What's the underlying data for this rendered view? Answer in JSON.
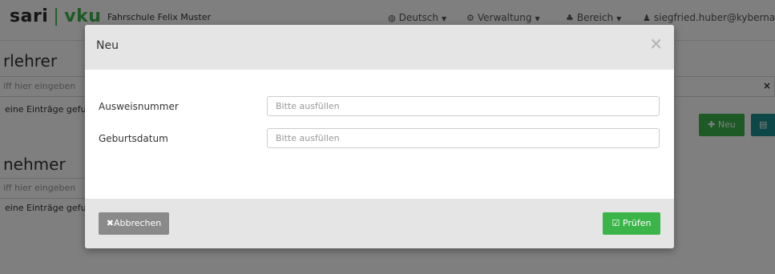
{
  "navbar": {
    "logo_sari": "sari",
    "logo_sep": "|",
    "logo_vku": "vku",
    "org_name": "Fahrschule Felix Muster",
    "language": "Deutsch",
    "admin": "Verwaltung",
    "area": "Bereich",
    "user_email": "siegfried.huber@kyberna.co"
  },
  "background": {
    "section1_title": "rlehrer",
    "section1_search_placeholder": "iff hier eingeben",
    "section1_empty": "eine Einträge gefur",
    "section2_title": "nehmer",
    "section2_search_placeholder": "iff hier eingeben",
    "section2_empty": "eine Einträge gefur",
    "clear_icon": "×",
    "new_button_label": "Neu"
  },
  "modal": {
    "title": "Neu",
    "close_icon": "×",
    "fields": [
      {
        "label": "Ausweisnummer",
        "placeholder": "Bitte ausfüllen",
        "value": ""
      },
      {
        "label": "Geburtsdatum",
        "placeholder": "Bitte ausfüllen",
        "value": ""
      }
    ],
    "cancel_label": "Abbrechen",
    "check_label": "Prüfen"
  },
  "colors": {
    "brand_green": "#3bb54a",
    "teal": "#1c8f91",
    "cancel_gray": "#8a8a8a",
    "modal_header_bg": "#e5e5e5"
  }
}
